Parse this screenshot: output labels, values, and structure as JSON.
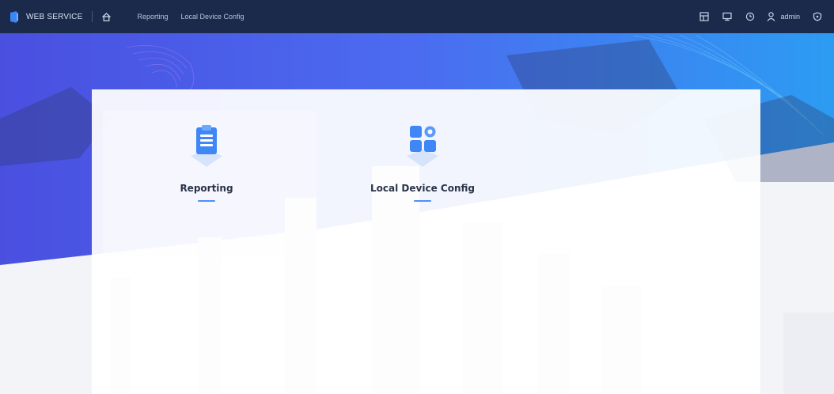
{
  "header": {
    "brand": "WEB SERVICE",
    "nav": [
      {
        "label": "Reporting"
      },
      {
        "label": "Local Device Config"
      }
    ],
    "user": "admin",
    "icons": [
      "home-icon",
      "layout-icon",
      "monitor-icon",
      "clock-icon",
      "user-icon",
      "shield-icon"
    ]
  },
  "tiles": [
    {
      "label": "Reporting",
      "icon": "clipboard-icon"
    },
    {
      "label": "Local Device Config",
      "icon": "apps-gear-icon"
    }
  ],
  "colors": {
    "topbar": "#1b2a4a",
    "accent": "#4f8ef7",
    "banner_start": "#4a5be8",
    "banner_end": "#2f9bf0"
  }
}
